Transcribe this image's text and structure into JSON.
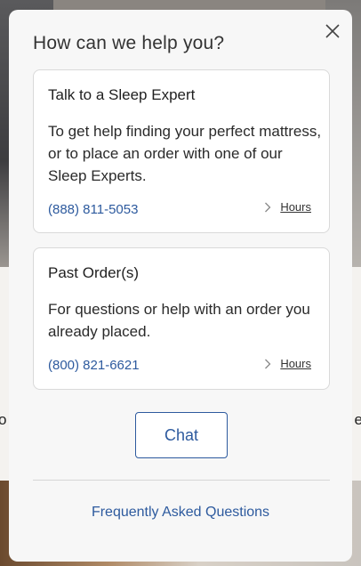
{
  "background": {
    "left_fragment": "o",
    "right_fragment": "e"
  },
  "modal": {
    "title": "How can we help you?",
    "close_icon": "close-icon"
  },
  "cards": [
    {
      "title": "Talk to a Sleep Expert",
      "description": "To get help finding your perfect mattress, or to place an order with one of our Sleep Experts.",
      "phone": "(888) 811-5053",
      "hours_label": "Hours"
    },
    {
      "title": "Past Order(s)",
      "description": "For questions or help with an order you already placed.",
      "phone": "(800) 821-6621",
      "hours_label": "Hours"
    }
  ],
  "chat_button": "Chat",
  "faq_link": "Frequently Asked Questions",
  "colors": {
    "accent": "#2d5a9e",
    "modal_bg": "#f7f7f7",
    "card_border": "#d9d9d9"
  }
}
